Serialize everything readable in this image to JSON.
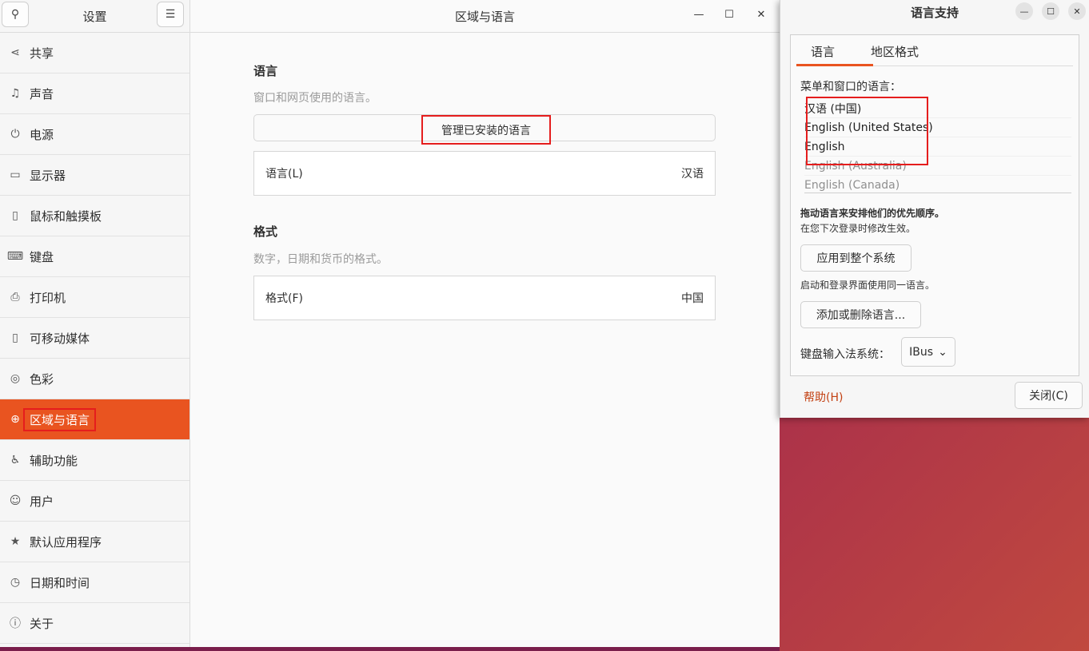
{
  "settings": {
    "sidebar_title": "设置",
    "search_icon": "search-icon",
    "menu_icon": "hamburger-icon",
    "items": [
      {
        "label": "共享",
        "icon": "share-icon",
        "glyph": "⋖"
      },
      {
        "label": "声音",
        "icon": "music-note-icon",
        "glyph": "♫"
      },
      {
        "label": "电源",
        "icon": "power-icon",
        "glyph": "⏻"
      },
      {
        "label": "显示器",
        "icon": "monitor-icon",
        "glyph": "▭"
      },
      {
        "label": "鼠标和触摸板",
        "icon": "mouse-icon",
        "glyph": "▯"
      },
      {
        "label": "键盘",
        "icon": "keyboard-icon",
        "glyph": "⌨"
      },
      {
        "label": "打印机",
        "icon": "printer-icon",
        "glyph": "⎙"
      },
      {
        "label": "可移动媒体",
        "icon": "usb-media-icon",
        "glyph": "▯"
      },
      {
        "label": "色彩",
        "icon": "color-icon",
        "glyph": "◎"
      },
      {
        "label": "区域与语言",
        "icon": "globe-icon",
        "glyph": "⊕",
        "active": true
      },
      {
        "label": "辅助功能",
        "icon": "accessibility-icon",
        "glyph": "♿"
      },
      {
        "label": "用户",
        "icon": "user-icon",
        "glyph": "☺"
      },
      {
        "label": "默认应用程序",
        "icon": "star-icon",
        "glyph": "★"
      },
      {
        "label": "日期和时间",
        "icon": "clock-icon",
        "glyph": "◷"
      },
      {
        "label": "关于",
        "icon": "info-icon",
        "glyph": "ⓘ"
      }
    ],
    "main_title": "区域与语言",
    "language_section_title": "语言",
    "language_section_sub": "窗口和网页使用的语言。",
    "manage_button": "管理已安装的语言",
    "language_row_label": "语言(L)",
    "language_row_value": "汉语",
    "format_section_title": "格式",
    "format_section_sub": "数字，日期和货币的格式。",
    "format_row_label": "格式(F)",
    "format_row_value": "中国"
  },
  "dialog": {
    "title": "语言支持",
    "tabs": [
      "语言",
      "地区格式"
    ],
    "menu_lang_label": "菜单和窗口的语言：",
    "languages": [
      "汉语 (中国)",
      "English (United States)",
      "English",
      "English (Australia)",
      "English (Canada)"
    ],
    "drag_hint": "拖动语言来安排他们的优先顺序。",
    "apply_hint": "在您下次登录时修改生效。",
    "apply_button": "应用到整个系统",
    "login_hint": "启动和登录界面使用同一语言。",
    "add_remove_button": "添加或删除语言...",
    "keyboard_label": "键盘输入法系统：",
    "keyboard_value": "IBus",
    "help_link": "帮助(H)",
    "close_button": "关闭(C)"
  },
  "colors": {
    "accent": "#e95420",
    "highlight_box": "#e51d1d"
  }
}
